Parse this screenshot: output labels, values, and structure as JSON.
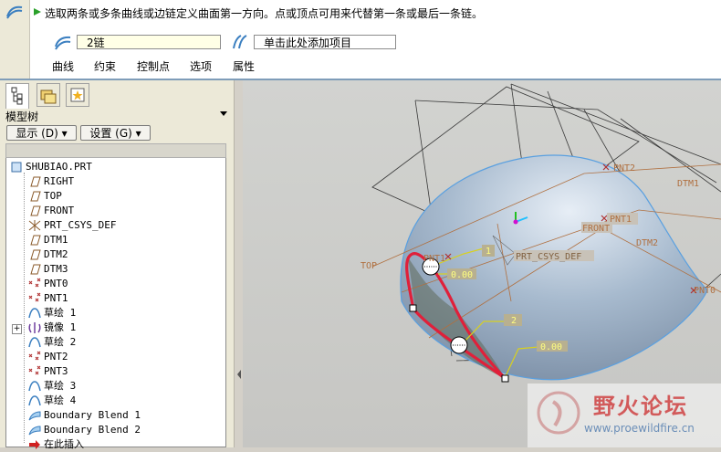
{
  "prompt": {
    "message": "选取两条或多条曲线或边链定义曲面第一方向。点或顶点可用来代替第一条或最后一条链。"
  },
  "collectors": {
    "chain_value": "2链",
    "add_item": "单击此处添加项目"
  },
  "tabs": [
    "曲线",
    "约束",
    "控制点",
    "选项",
    "属性"
  ],
  "panel": {
    "header": "模型树",
    "show_button": "显示 (D) ▾",
    "settings_button": "设置 (G) ▾",
    "tree": [
      {
        "label": "SHUBIAO.PRT",
        "icon": "part-icon"
      },
      {
        "label": "RIGHT",
        "icon": "datum-plane-icon"
      },
      {
        "label": "TOP",
        "icon": "datum-plane-icon"
      },
      {
        "label": "FRONT",
        "icon": "datum-plane-icon"
      },
      {
        "label": "PRT_CSYS_DEF",
        "icon": "csys-icon"
      },
      {
        "label": "DTM1",
        "icon": "datum-plane-icon"
      },
      {
        "label": "DTM2",
        "icon": "datum-plane-icon"
      },
      {
        "label": "DTM3",
        "icon": "datum-plane-icon"
      },
      {
        "label": "PNT0",
        "icon": "datum-point-icon"
      },
      {
        "label": "PNT1",
        "icon": "datum-point-icon"
      },
      {
        "label": "草绘 1",
        "icon": "sketch-icon"
      },
      {
        "label": "镜像 1",
        "icon": "mirror-icon"
      },
      {
        "label": "草绘 2",
        "icon": "sketch-icon"
      },
      {
        "label": "PNT2",
        "icon": "datum-point-icon"
      },
      {
        "label": "PNT3",
        "icon": "datum-point-icon"
      },
      {
        "label": "草绘 3",
        "icon": "sketch-icon"
      },
      {
        "label": "草绘 4",
        "icon": "sketch-icon"
      },
      {
        "label": "Boundary Blend 1",
        "icon": "boundary-blend-icon"
      },
      {
        "label": "Boundary Blend 2",
        "icon": "boundary-blend-icon"
      },
      {
        "label": "在此插入",
        "icon": "insert-arrow-icon"
      }
    ]
  },
  "viewport": {
    "labels": {
      "pnt2": "PNT2",
      "dtm1": "DTM1",
      "pnt1": "PNT1",
      "front": "FRONT",
      "dtm2": "DTM2",
      "prt_csys_def": "PRT_CSYS_DEF",
      "top": "TOP",
      "pnt0": "PNT0",
      "pnt_t1": "PNT1",
      "dim1": "0.00",
      "dim2": "0.00",
      "tag1": "1",
      "tag2": "2"
    }
  },
  "watermark": {
    "title": "野火论坛",
    "url": "www.proewildfire.cn"
  },
  "colors": {
    "surface": "#a9bdd4",
    "chain": "#e0203a",
    "datum": "#b07040",
    "accent": "#7f9db9"
  }
}
